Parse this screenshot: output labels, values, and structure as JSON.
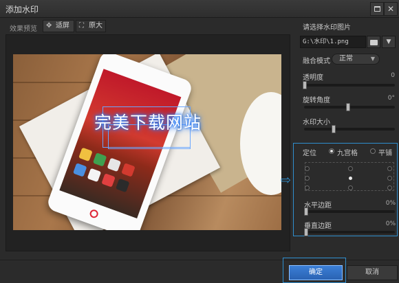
{
  "window": {
    "title": "添加水印"
  },
  "preview": {
    "label": "效果预览",
    "fit_label": "适屏",
    "original_label": "原大",
    "watermark_text": "完美下载网站"
  },
  "settings": {
    "choose_image_label": "请选择水印图片",
    "image_path": "G:\\水印\\1.png",
    "blend_label": "融合模式",
    "blend_value": "正常",
    "opacity_label": "透明度",
    "opacity_value": "0",
    "opacity_level": 0,
    "rotation_label": "旋转角度",
    "rotation_value": "0°",
    "rotation_level": 0.5,
    "size_label": "水印大小",
    "size_level": 0.33,
    "position_label": "定位",
    "grid_option": "九宫格",
    "tile_option": "平铺",
    "h_margin_label": "水平边距",
    "h_margin_value": "0%",
    "v_margin_label": "垂直边距",
    "v_margin_value": "0%"
  },
  "buttons": {
    "ok": "确定",
    "cancel": "取消"
  },
  "colors": {
    "accent": "#2f8fd0",
    "ok_button": "#3b7fd6",
    "background": "#2b2b2b"
  }
}
